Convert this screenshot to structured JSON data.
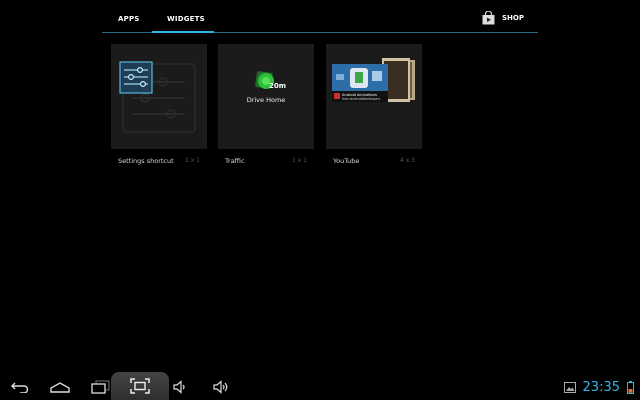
{
  "tabs": {
    "apps": "APPS",
    "widgets": "WIDGETS",
    "shop": "SHOP"
  },
  "widgets": [
    {
      "name": "Settings shortcut",
      "dims": "1 x 1"
    },
    {
      "name": "Traffic",
      "dims": "1 x 1",
      "preview_label": "Drive Home",
      "preview_time": "20m"
    },
    {
      "name": "YouTube",
      "dims": "4 x 3",
      "preview_title": "Android Activations",
      "preview_sub": "from androiddevelopers"
    }
  ],
  "icons": {
    "back": "back-arrow-icon",
    "home": "home-icon",
    "recent": "recent-apps-icon",
    "screenshot": "screenshot-icon",
    "volume_down": "volume-down-icon",
    "volume_up": "volume-up-icon",
    "gallery": "gallery-notification-icon",
    "battery": "battery-icon",
    "shop": "play-store-bag-icon"
  },
  "status": {
    "time": "23:35"
  },
  "colors": {
    "accent": "#33b5e5",
    "background": "#000000",
    "card": "#1b1b1b"
  }
}
